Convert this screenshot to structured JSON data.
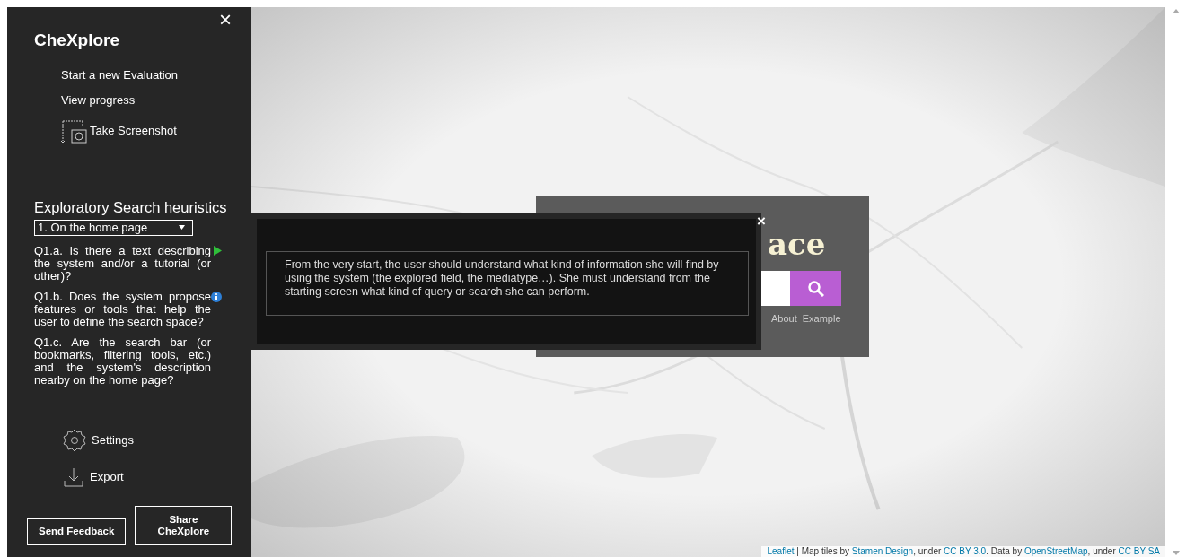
{
  "sidebar": {
    "close": "×",
    "title": "CheXplore",
    "menu": [
      {
        "label": "Start a new Evaluation",
        "kind": "plain"
      },
      {
        "label": "View progress",
        "kind": "plain"
      },
      {
        "label": "Take Screenshot",
        "kind": "screenshot"
      }
    ],
    "heuristics": {
      "heading": "Exploratory Search heuristics",
      "section": {
        "value": "1. On the home page"
      },
      "questions": [
        {
          "text": "Q1.a. Is there a text describing the system and/or a tutorial (or other)?",
          "kind": "play"
        },
        {
          "text": "Q1.b. Does the system propose features or tools that help the user to define the search space?",
          "kind": "info"
        },
        {
          "text": "Q1.c. Are the search bar (or bookmarks, filtering tools, etc.) and the system's description nearby on the home page?",
          "kind": "plain"
        }
      ]
    },
    "actions": [
      {
        "label": "Settings",
        "kind": "settings"
      },
      {
        "label": "Export",
        "kind": "export"
      }
    ],
    "buttons": [
      {
        "label": "Send Feedback"
      },
      {
        "label": "Share CheXplore"
      }
    ]
  },
  "map": {
    "kind": "picture",
    "app_panel": {
      "title": "ace",
      "links": [
        "About",
        "Example"
      ]
    },
    "tooltip": {
      "close": "×",
      "text": "From the very start, the user should understand what kind of information she will find by using the system (the explored field, the mediatype…). She must understand from the starting screen what kind of query or search she can perform."
    },
    "attribution": [
      {
        "text": "Leaflet",
        "kind": "link"
      },
      {
        "text": " | Map tiles by ",
        "kind": "text"
      },
      {
        "text": "Stamen Design",
        "kind": "link"
      },
      {
        "text": ", under ",
        "kind": "text"
      },
      {
        "text": "CC BY 3.0",
        "kind": "link"
      },
      {
        "text": ". Data by ",
        "kind": "text"
      },
      {
        "text": "OpenStreetMap",
        "kind": "link"
      },
      {
        "text": ", under ",
        "kind": "text"
      },
      {
        "text": "CC BY SA",
        "kind": "link"
      }
    ]
  }
}
